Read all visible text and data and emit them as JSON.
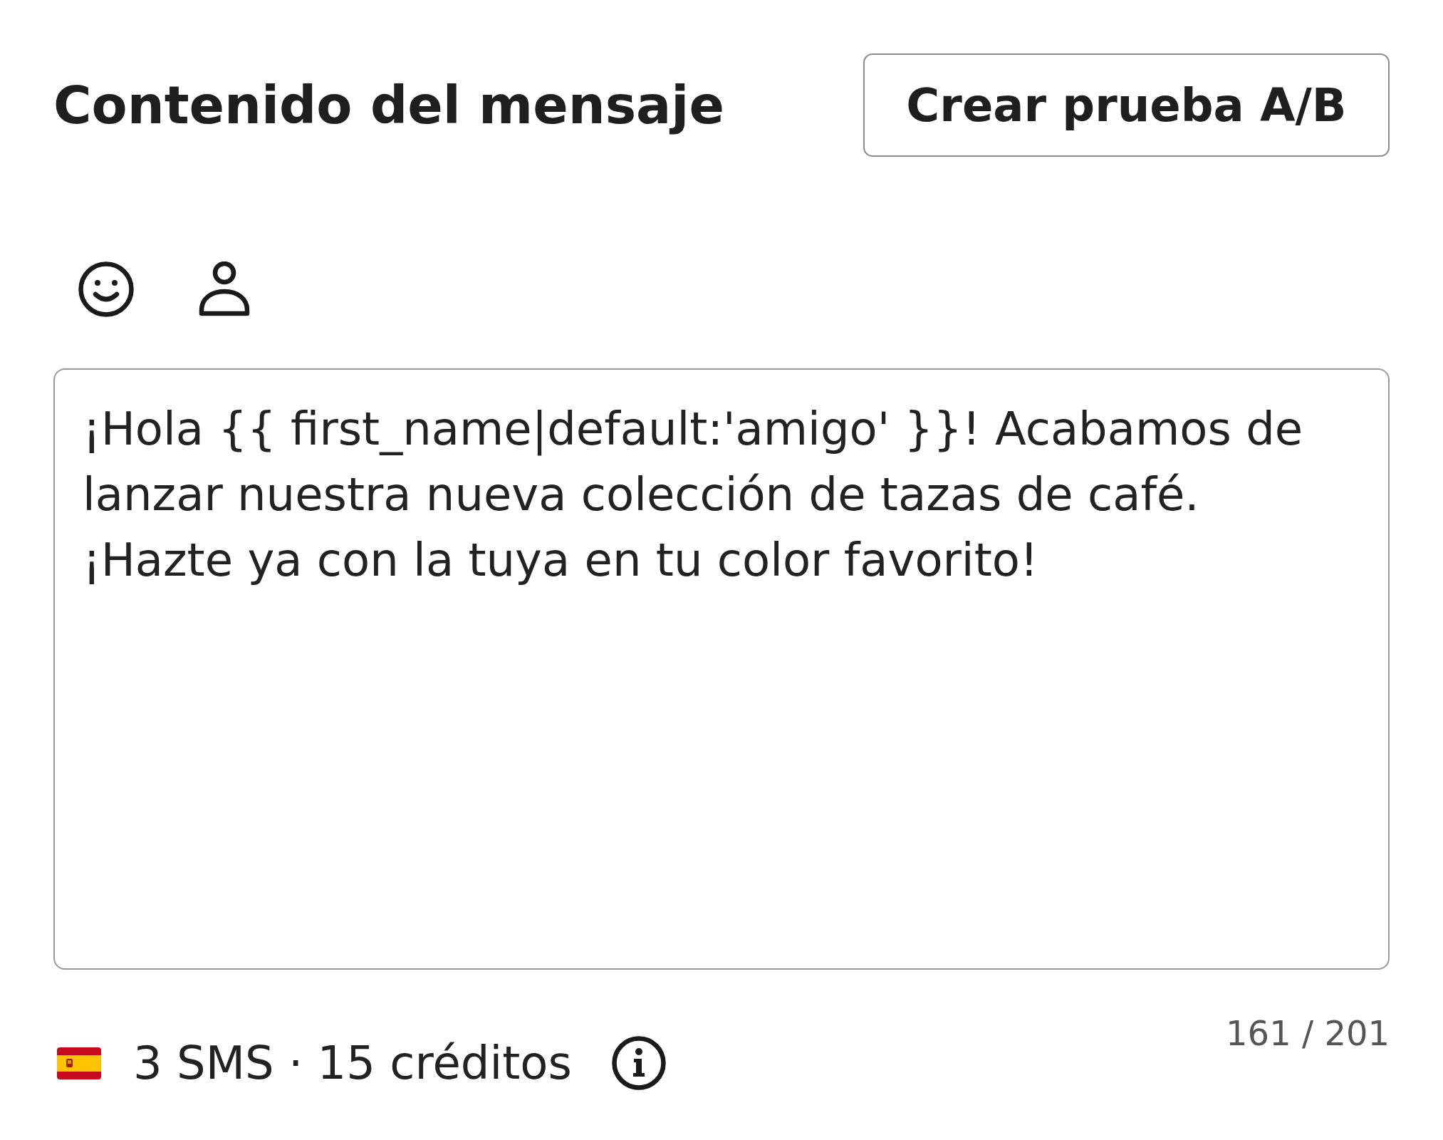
{
  "header": {
    "title": "Contenido del mensaje",
    "ab_test_button": "Crear prueba A/B"
  },
  "message": {
    "value": "¡Hola {{ first_name|default:'amigo' }}! Acabamos de lanzar nuestra nueva colección de tazas de café. ¡Hazte ya con la tuya en tu color favorito!"
  },
  "footer": {
    "summary": "3 SMS · 15 créditos",
    "character_count": "161 / 201"
  }
}
